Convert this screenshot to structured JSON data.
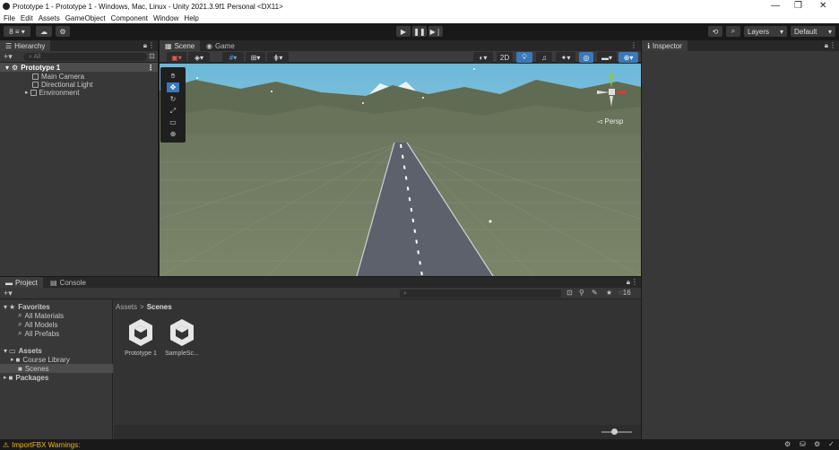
{
  "window": {
    "title": "Prototype 1 - Prototype 1 - Windows, Mac, Linux - Unity 2021.3.9f1 Personal <DX11>",
    "controls": [
      "—",
      "❐",
      "✕"
    ]
  },
  "menu": [
    "File",
    "Edit",
    "Assets",
    "GameObject",
    "Component",
    "Window",
    "Help"
  ],
  "toolbar": {
    "account_label": "8 ≡ ▾",
    "layers": "Layers",
    "layout": "Default"
  },
  "hierarchy": {
    "tab": "Hierarchy",
    "search_placeholder": "All",
    "scene": "Prototype 1",
    "items": [
      "Main Camera",
      "Directional Light",
      "Environment"
    ]
  },
  "scene_view": {
    "tabs": [
      "Scene",
      "Game"
    ],
    "persp": "◅ Persp",
    "mode_2d": "2D",
    "axes": [
      "y",
      "z",
      "x"
    ]
  },
  "inspector": {
    "tab": "Inspector"
  },
  "project": {
    "tabs": [
      "Project",
      "Console"
    ],
    "favorites_label": "Favorites",
    "favorites": [
      "All Materials",
      "All Models",
      "All Prefabs"
    ],
    "assets_label": "Assets",
    "assets": [
      "Course Library",
      "Scenes"
    ],
    "packages_label": "Packages",
    "breadcrumb_root": "Assets",
    "breadcrumb_sep": ">",
    "breadcrumb_current": "Scenes",
    "files": [
      "Prototype 1",
      "SampleSc..."
    ],
    "visible_count": "16",
    "zoom": 0.4
  },
  "status": {
    "warning": "ImportFBX Warnings:"
  },
  "colors": {
    "sky_top": "#6bb8d8",
    "sky_bottom": "#c0dcec",
    "ground": "#7a8568",
    "road": "#5c616b",
    "selection": "#2c5d87",
    "accent_blue": "#3a79bb",
    "warning": "#f3b91f"
  }
}
